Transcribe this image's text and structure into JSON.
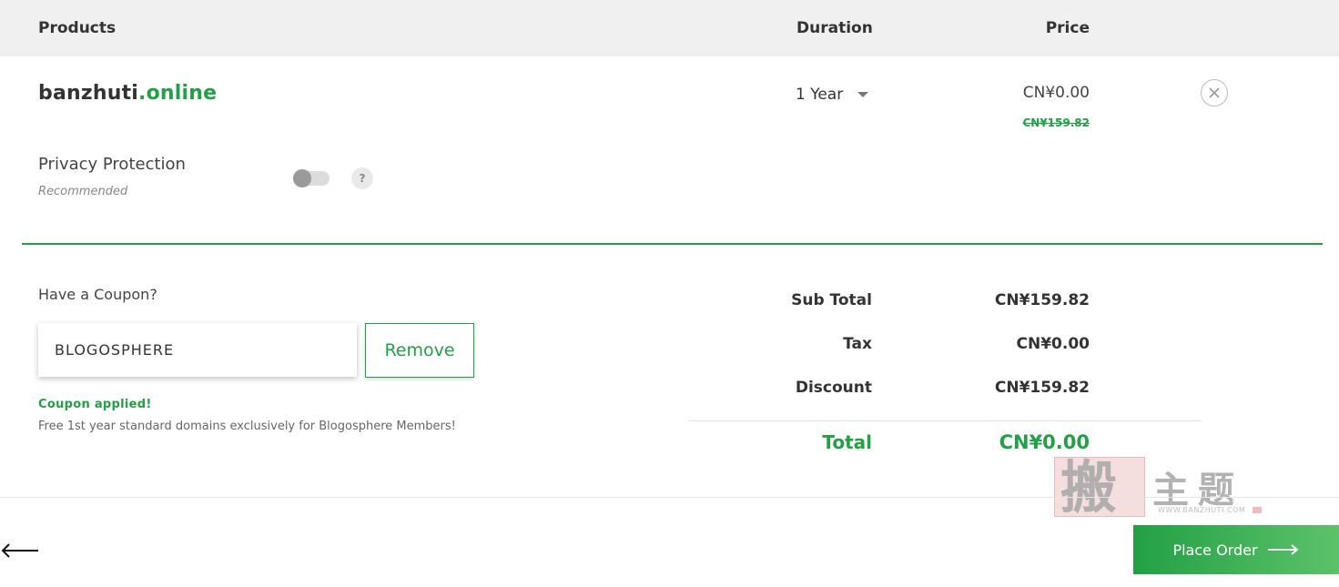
{
  "table_header": {
    "products": "Products",
    "duration": "Duration",
    "price": "Price"
  },
  "product": {
    "domain_name": "banzhuti",
    "domain_tld": ".online",
    "duration": "1 Year",
    "price_now": "CN¥0.00",
    "price_original": "CN¥159.82"
  },
  "privacy": {
    "label": "Privacy Protection",
    "sublabel": "Recommended",
    "enabled": false,
    "help_glyph": "?"
  },
  "coupon": {
    "label": "Have a Coupon?",
    "code": "BLOGOSPHERE",
    "remove_label": "Remove",
    "status": "Coupon applied!",
    "description": "Free 1st year standard domains exclusively for Blogosphere Members!"
  },
  "summary": {
    "subtotal_label": "Sub Total",
    "subtotal_value": "CN¥159.82",
    "tax_label": "Tax",
    "tax_value": "CN¥0.00",
    "discount_label": "Discount",
    "discount_value": "CN¥159.82",
    "total_label": "Total",
    "total_value": "CN¥0.00"
  },
  "footer": {
    "place_order_label": "Place Order",
    "back_icon": "arrow-left-icon",
    "next_icon": "arrow-right-icon"
  },
  "watermark": {
    "seal_char": "搬",
    "text": "主题",
    "url": "WWW.BANZHUTI.COM"
  },
  "colors": {
    "accent": "#22a045",
    "header_bg": "#f0f0f0"
  }
}
